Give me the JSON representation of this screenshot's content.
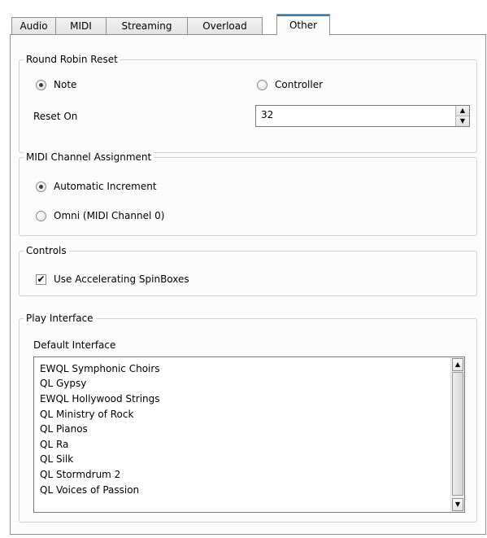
{
  "tabs": [
    "Audio",
    "MIDI",
    "Streaming",
    "Overload",
    "Other"
  ],
  "active_tab": "Other",
  "round_robin": {
    "title": "Round Robin Reset",
    "note_label": "Note",
    "controller_label": "Controller",
    "selected": "Note",
    "reset_on_label": "Reset On",
    "reset_on_value": "32"
  },
  "midi_channel": {
    "title": "MIDI Channel Assignment",
    "auto_label": "Automatic Increment",
    "omni_label": "Omni (MIDI Channel 0)",
    "selected": "Automatic Increment"
  },
  "controls": {
    "title": "Controls",
    "accel_label": "Use Accelerating SpinBoxes",
    "accel_checked": true,
    "check_glyph": "✔"
  },
  "play_interface": {
    "title": "Play Interface",
    "default_label": "Default Interface",
    "items": [
      "EWQL Symphonic Choirs",
      "QL Gypsy",
      "EWQL Hollywood Strings",
      "QL Ministry of Rock",
      "QL Pianos",
      "QL Ra",
      "QL Silk",
      "QL Stormdrum 2",
      "QL Voices of Passion"
    ]
  },
  "icons": {
    "spin_up": "▲",
    "spin_down": "▼",
    "scroll_up": "▲",
    "scroll_down": "▼"
  }
}
